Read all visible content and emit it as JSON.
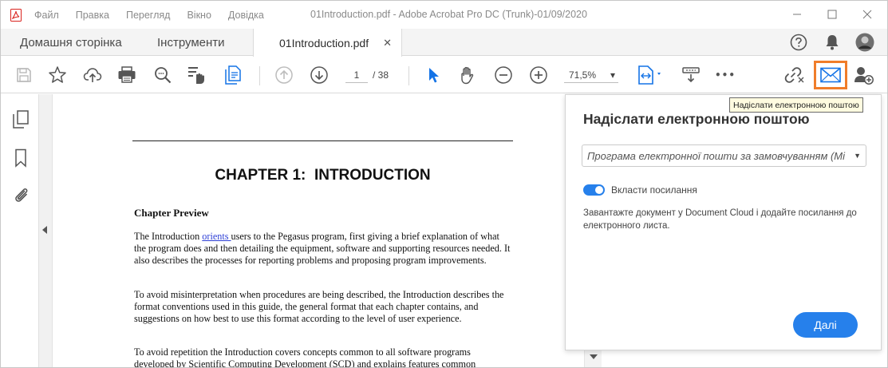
{
  "window": {
    "title": "01Introduction.pdf - Adobe Acrobat Pro DC (Trunk)-01/09/2020",
    "menu": [
      "Файл",
      "Правка",
      "Перегляд",
      "Вікно",
      "Довідка"
    ]
  },
  "tabs": {
    "home": "Домашня сторінка",
    "tools": "Інструменти",
    "document": "01Introduction.pdf",
    "close_glyph": "✕"
  },
  "toolbar": {
    "page_current": "1",
    "page_total": "/ 38",
    "zoom": "71,5%",
    "zoom_arrow": "▾",
    "more": "•••"
  },
  "document": {
    "chapter_title": "CHAPTER 1:  INTRODUCTION",
    "section_title": "Chapter Preview",
    "para1_before_link": "The Introduction ",
    "para1_link": "orients ",
    "para1_after_link": "users to the Pegasus program, first giving a brief explanation of what the program does and then detailing the equipment, software and supporting resources needed.  It also describes the processes for reporting problems and proposing program improvements.",
    "para2": "To avoid misinterpretation when procedures are being described, the Introduction describes the format conventions used in this guide, the general format that each chapter contains, and suggestions on how best to use this format according to the level of user experience.",
    "para3": "To avoid repetition the Introduction covers concepts common to all software programs developed by Scientific Computing Development (SCD) and explains features common"
  },
  "email_panel": {
    "title": "Надіслати електронною поштою",
    "client_select": "Програма електронної пошти за замовчуванням (Mi",
    "select_arrow": "▼",
    "toggle_label": "Вкласти посилання",
    "toggle_on": true,
    "description": "Завантажте документ у Document Cloud і додайте посилання до електронного листа.",
    "next_button": "Далі"
  },
  "tooltip": {
    "text": "Надіслати електронною поштою"
  },
  "colors": {
    "accent_blue": "#2680eb",
    "highlight_orange": "#f07d2a",
    "acrobat_red": "#d9231e",
    "select_tool_blue": "#1473e6"
  }
}
